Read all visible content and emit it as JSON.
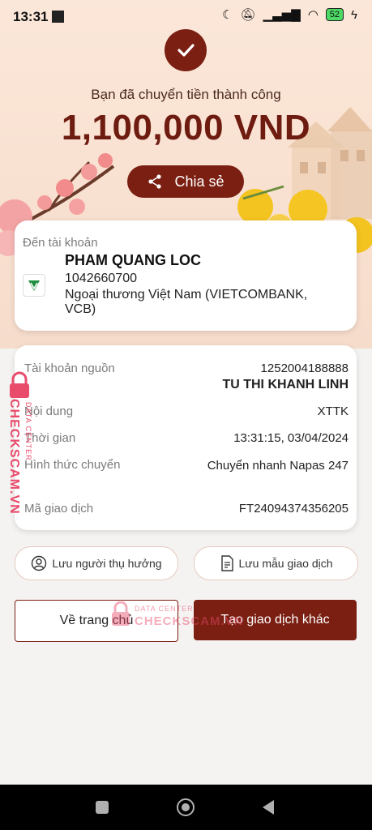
{
  "status": {
    "time": "13:31",
    "battery": "52"
  },
  "header": {
    "subtitle": "Bạn đã chuyển tiền thành công",
    "amount": "1,100,000 VND",
    "share_label": "Chia sẻ"
  },
  "recipient": {
    "label": "Đến tài khoản",
    "name": "PHAM QUANG LOC",
    "account": "1042660700",
    "bank": "Ngoại thương Việt Nam (VIETCOMBANK, VCB)"
  },
  "details": {
    "source_label": "Tài khoản nguồn",
    "source_account": "1252004188888",
    "source_name": "TU THI KHANH LINH",
    "content_label": "Nội dung",
    "content_value": "XTTK",
    "time_label": "Thời gian",
    "time_value": "13:31:15, 03/04/2024",
    "method_label": "Hình thức chuyển",
    "method_value": "Chuyển nhanh Napas 247",
    "txid_label": "Mã giao dịch",
    "txid_value": "FT24094374356205"
  },
  "actions": {
    "save_beneficiary": "Lưu người thụ hưởng",
    "save_template": "Lưu mẫu giao dịch",
    "home": "Về trang chủ",
    "new_transaction": "Tạo giao dịch khác"
  },
  "watermark": {
    "brand": "CHECKSCAM.VN",
    "tag": "DATA CENTER"
  },
  "colors": {
    "primary": "#7a1f12",
    "background": "#f5f3f2"
  }
}
